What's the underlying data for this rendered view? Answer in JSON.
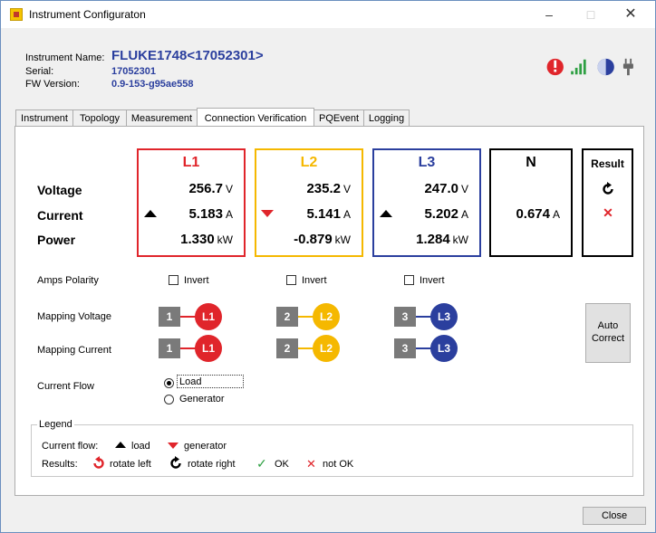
{
  "window": {
    "title": "Instrument Configuraton",
    "min": "–",
    "max": "□",
    "close": "✕"
  },
  "info": {
    "name_label": "Instrument Name:",
    "name_value": "FLUKE1748<17052301>",
    "serial_label": "Serial:",
    "serial_value": "17052301",
    "fw_label": "FW Version:",
    "fw_value": "0.9-153-g95ae558"
  },
  "status_icons": [
    "info-alert-icon",
    "signal-bars-icon",
    "battery-pie-icon",
    "power-plug-icon"
  ],
  "tabs": [
    "Instrument",
    "Topology",
    "Measurement",
    "Connection Verification",
    "PQEvent",
    "Logging"
  ],
  "active_tab": "Connection Verification",
  "rows": {
    "voltage": "Voltage",
    "current": "Current",
    "power": "Power"
  },
  "phases": [
    {
      "name": "L1",
      "color": "#e0252b",
      "voltage": "256.7",
      "voltage_unit": "V",
      "current": "5.183",
      "current_unit": "A",
      "power": "1.330",
      "power_unit": "kW",
      "flow": "load"
    },
    {
      "name": "L2",
      "color": "#f5b800",
      "voltage": "235.2",
      "voltage_unit": "V",
      "current": "5.141",
      "current_unit": "A",
      "power": "-0.879",
      "power_unit": "kW",
      "flow": "generator"
    },
    {
      "name": "L3",
      "color": "#2b3f9e",
      "voltage": "247.0",
      "voltage_unit": "V",
      "current": "5.202",
      "current_unit": "A",
      "power": "1.284",
      "power_unit": "kW",
      "flow": "load"
    }
  ],
  "neutral": {
    "name": "N",
    "current": "0.674",
    "current_unit": "A"
  },
  "result": {
    "title": "Result",
    "voltage_icon": "rotate-right-icon",
    "current_icon": "not-ok-icon"
  },
  "amps_polarity": {
    "label": "Amps Polarity",
    "invert": "Invert"
  },
  "mapping_voltage": {
    "label": "Mapping Voltage",
    "numbers": [
      "1",
      "2",
      "3"
    ],
    "phases": [
      "L1",
      "L2",
      "L3"
    ]
  },
  "mapping_current": {
    "label": "Mapping Current",
    "numbers": [
      "1",
      "2",
      "3"
    ],
    "phases": [
      "L1",
      "L2",
      "L3"
    ]
  },
  "auto_correct": {
    "line1": "Auto",
    "line2": "Correct"
  },
  "current_flow": {
    "label": "Current Flow",
    "options": [
      "Load",
      "Generator"
    ],
    "selected": "Load"
  },
  "legend": {
    "title": "Legend",
    "current_flow_label": "Current flow:",
    "load": "load",
    "generator": "generator",
    "results_label": "Results:",
    "rotate_left": "rotate left",
    "rotate_right": "rotate right",
    "ok": "OK",
    "not_ok": "not OK"
  },
  "close_button": "Close"
}
